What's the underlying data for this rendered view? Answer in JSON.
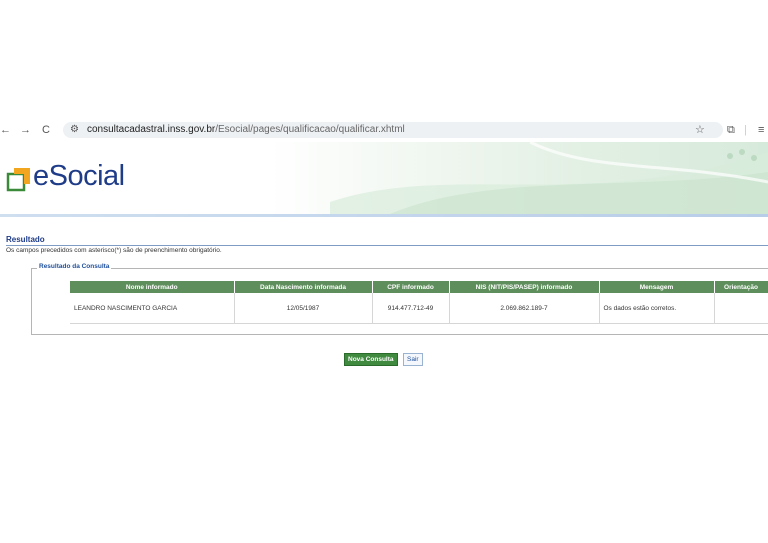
{
  "browser": {
    "url_host": "consultacadastral.inss.gov.br",
    "url_path": "/Esocial/pages/qualificacao/qualificar.xhtml",
    "icons": [
      "back-arrow-icon",
      "forward-arrow-icon",
      "reload-icon",
      "site-settings-icon",
      "star-icon",
      "extensions-icon",
      "menu-icon"
    ]
  },
  "banner": {
    "logo_text": "eSocial"
  },
  "section": {
    "title": "Resultado",
    "note": "Os campos precedidos com asterisco(*) são de preenchimento obrigatório."
  },
  "result": {
    "legend": "Resultado da Consulta",
    "headers": [
      "Nome informado",
      "Data Nascimento informada",
      "CPF informado",
      "NIS (NIT/PIS/PASEP) informado",
      "Mensagem",
      "Orientação"
    ],
    "row": {
      "nome": "LEANDRO NASCIMENTO GARCIA",
      "data_nascimento": "12/05/1987",
      "cpf": "914.477.712-49",
      "nis": "2.069.862.189-7",
      "mensagem": "Os dados estão corretos.",
      "orientacao": ""
    }
  },
  "buttons": {
    "nova_consulta": "Nova Consulta",
    "sair": "Sair"
  },
  "colors": {
    "header_green": "#5e8e5c",
    "logo_blue": "#1f3c88",
    "button_green": "#3f8a3f"
  }
}
